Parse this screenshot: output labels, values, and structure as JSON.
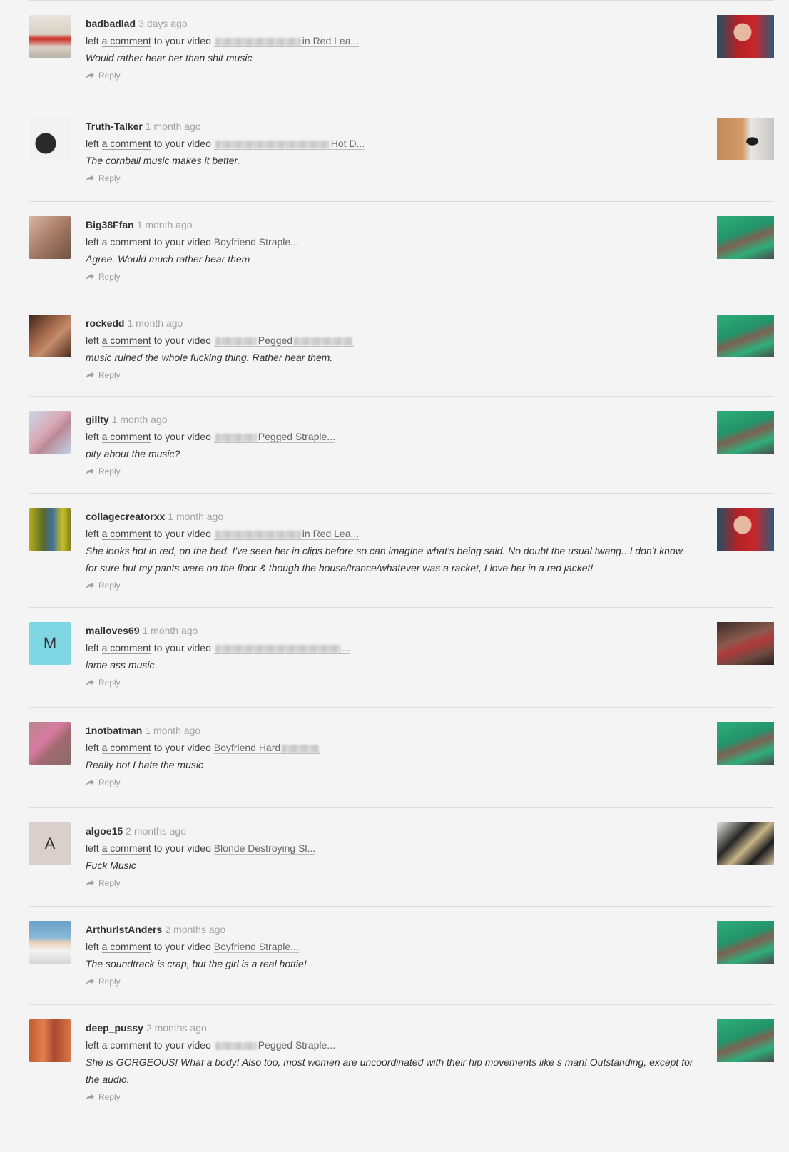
{
  "common": {
    "left_text": "left",
    "comment_link": "a comment",
    "to_video_text": "to your video",
    "reply_label": "Reply"
  },
  "items": [
    {
      "user": "badbadlad",
      "time": "3 days ago",
      "title_visible": "in Red Lea...",
      "comment": "Would rather hear her than shit music"
    },
    {
      "user": "Truth-Talker",
      "time": "1 month ago",
      "title_visible": "Hot D...",
      "comment": "The cornball music makes it better."
    },
    {
      "user": "Big38Ffan",
      "time": "1 month ago",
      "title_visible": "Boyfriend Straple...",
      "comment": "Agree. Would much rather hear them"
    },
    {
      "user": "rockedd",
      "time": "1 month ago",
      "title_visible": "Pegged",
      "comment": "music ruined the whole fucking thing. Rather hear them."
    },
    {
      "user": "gillty",
      "time": "1 month ago",
      "title_visible": "Pegged Straple...",
      "comment": "pity about the music?"
    },
    {
      "user": "collagecreatorxx",
      "time": "1 month ago",
      "title_visible": "in Red Lea...",
      "comment": "She looks hot in red, on the bed. I've seen her in clips before so can imagine what's being said. No doubt the usual twang.. I don't know for sure but my pants were on the floor & though the house/trance/whatever was a racket, I love her in a red jacket!"
    },
    {
      "user": "malloves69",
      "time": "1 month ago",
      "avatar_letter": "M",
      "avatar_color": "#7fd7e4",
      "title_visible": "...",
      "comment": "lame ass music"
    },
    {
      "user": "1notbatman",
      "time": "1 month ago",
      "title_visible": "Boyfriend Hard",
      "comment": "Really hot I hate the music"
    },
    {
      "user": "algoe15",
      "time": "2 months ago",
      "avatar_letter": "A",
      "avatar_color": "#d9cfcb",
      "title_visible": "Blonde Destroying Sl...",
      "comment": "Fuck Music"
    },
    {
      "user": "ArthurlstAnders",
      "time": "2 months ago",
      "title_visible": "Boyfriend Straple...",
      "comment": "The soundtrack is crap, but the girl is a real hottie!"
    },
    {
      "user": "deep_pussy",
      "time": "2 months ago",
      "title_visible": "Pegged Straple...",
      "comment": "She is GORGEOUS! What a body! Also too, most women are uncoordinated with their hip movements like s man! Outstanding, except for the audio."
    }
  ]
}
